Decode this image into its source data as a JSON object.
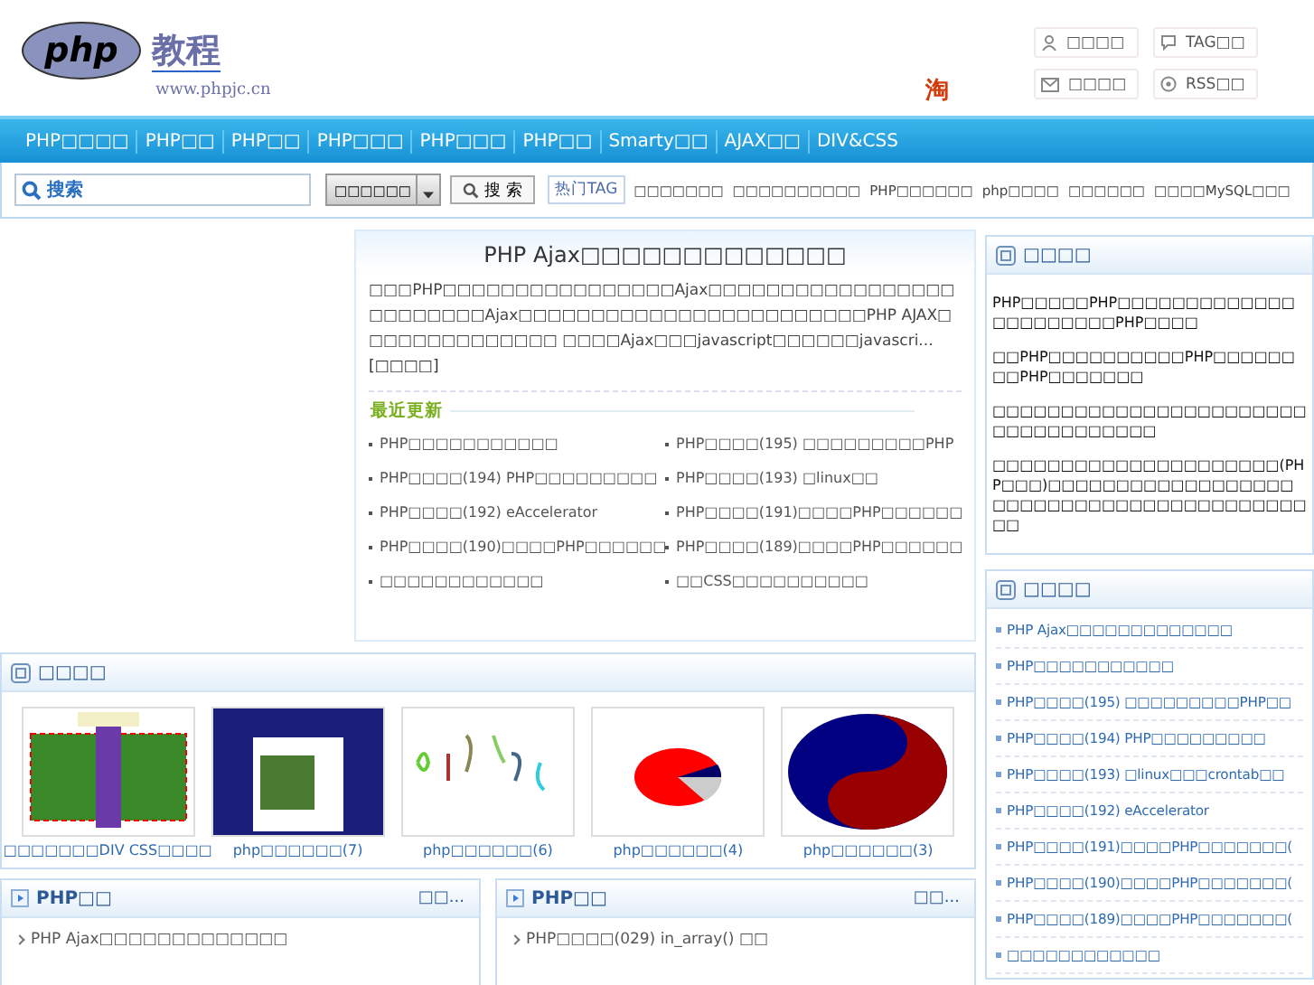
{
  "logo": {
    "mark": "php",
    "name": "教程",
    "subtitle": "www.phpjc.cn"
  },
  "header_links": [
    {
      "label": "□□□□",
      "kind": "user"
    },
    {
      "label": "TAG□□",
      "kind": "chat"
    },
    {
      "label": "□□□□",
      "kind": "mail"
    },
    {
      "label": "RSS□□",
      "kind": "rss"
    }
  ],
  "taobao": "淘",
  "nav": [
    "PHP□□□□",
    "PHP□□",
    "PHP□□",
    "PHP□□□",
    "PHP□□□",
    "PHP□□",
    "Smarty□□",
    "AJAX□□",
    "DIV&CSS"
  ],
  "search": {
    "placeholder": "搜索",
    "scope": "□□□□□□",
    "button": "搜 索"
  },
  "hot_tags": {
    "label": "热门TAG",
    "tags": [
      "□□□□□□□",
      "□□□□□□□□□□",
      "PHP□□□□□□",
      "php□□□□",
      "□□□□□□",
      "□□□□MySQL□□□"
    ]
  },
  "article": {
    "title": "PHP Ajax□□□□□□□□□□□□□",
    "summary": "□□□PHP□□□□□□□□□□□□□□□□Ajax□□□□□□□□□□□□□□□□□□□□□□□□□Ajax□□□□□□□□□□□□□□□□□□□□□□□□PHP AJAX□□□□□□□□□□□□□□ □□□□Ajax□□□javascript□□□□□□javascri...",
    "more": "[□□□□]",
    "recent_label": "最近更新",
    "recent": [
      "PHP□□□□□□□□□□□",
      "PHP□□□□(195) □□□□□□□□□PHP",
      "PHP□□□□(194) PHP□□□□□□□□□",
      "PHP□□□□(193) □linux□□",
      "PHP□□□□(192) eAccelerator",
      "PHP□□□□(191)□□□□PHP□□□□□□",
      "PHP□□□□(190)□□□□PHP□□□□□□",
      "PHP□□□□(189)□□□□PHP□□□□□□",
      "□□□□□□□□□□□□",
      "□□CSS□□□□□□□□□□"
    ]
  },
  "intro_panel": {
    "title": "□□□□",
    "paragraphs": [
      "PHP□□□□□PHP□□□□□□□□□□□□□□□□□□□□□□PHP□□□□",
      "□□PHP□□□□□□□□□□PHP□□□□□□□□PHP□□□□□□□",
      "□□□□□□□□□□□□□□□□□□□□□□□□□□□□□□□□□□□",
      "□□□□□□□□□□□□□□□□□□□□□(PHP□□□)□□□□□□□□□□□□□□□□□□□□□□□□□□□□□□□□□□□□□□□□□□□"
    ]
  },
  "hot_panel": {
    "title": "□□□□",
    "items": [
      "PHP Ajax□□□□□□□□□□□□□",
      "PHP□□□□□□□□□□□",
      "PHP□□□□(195) □□□□□□□□□PHP□□",
      "PHP□□□□(194) PHP□□□□□□□□□",
      "PHP□□□□(193) □linux□□□crontab□□",
      "PHP□□□□(192) eAccelerator",
      "PHP□□□□(191)□□□□PHP□□□□□□□(",
      "PHP□□□□(190)□□□□PHP□□□□□□□(",
      "PHP□□□□(189)□□□□PHP□□□□□□□(",
      "□□□□□□□□□□□□"
    ]
  },
  "gallery": {
    "title": "□□□□",
    "items": [
      {
        "caption": "□□□□□□□DIV CSS□□□□",
        "kind": "layout"
      },
      {
        "caption": "php□□□□□□(7)",
        "kind": "webpage"
      },
      {
        "caption": "php□□□□□□(6)",
        "kind": "captcha"
      },
      {
        "caption": "php□□□□□□(4)",
        "kind": "pie"
      },
      {
        "caption": "php□□□□□□(3)",
        "kind": "yinyang"
      }
    ]
  },
  "bottom_panels": [
    {
      "title": "PHP□□",
      "more": "□□...",
      "items": [
        "PHP Ajax□□□□□□□□□□□□□"
      ]
    },
    {
      "title": "PHP□□",
      "more": "□□...",
      "items": [
        "PHP□□□□(029) in_array() □□"
      ]
    }
  ]
}
